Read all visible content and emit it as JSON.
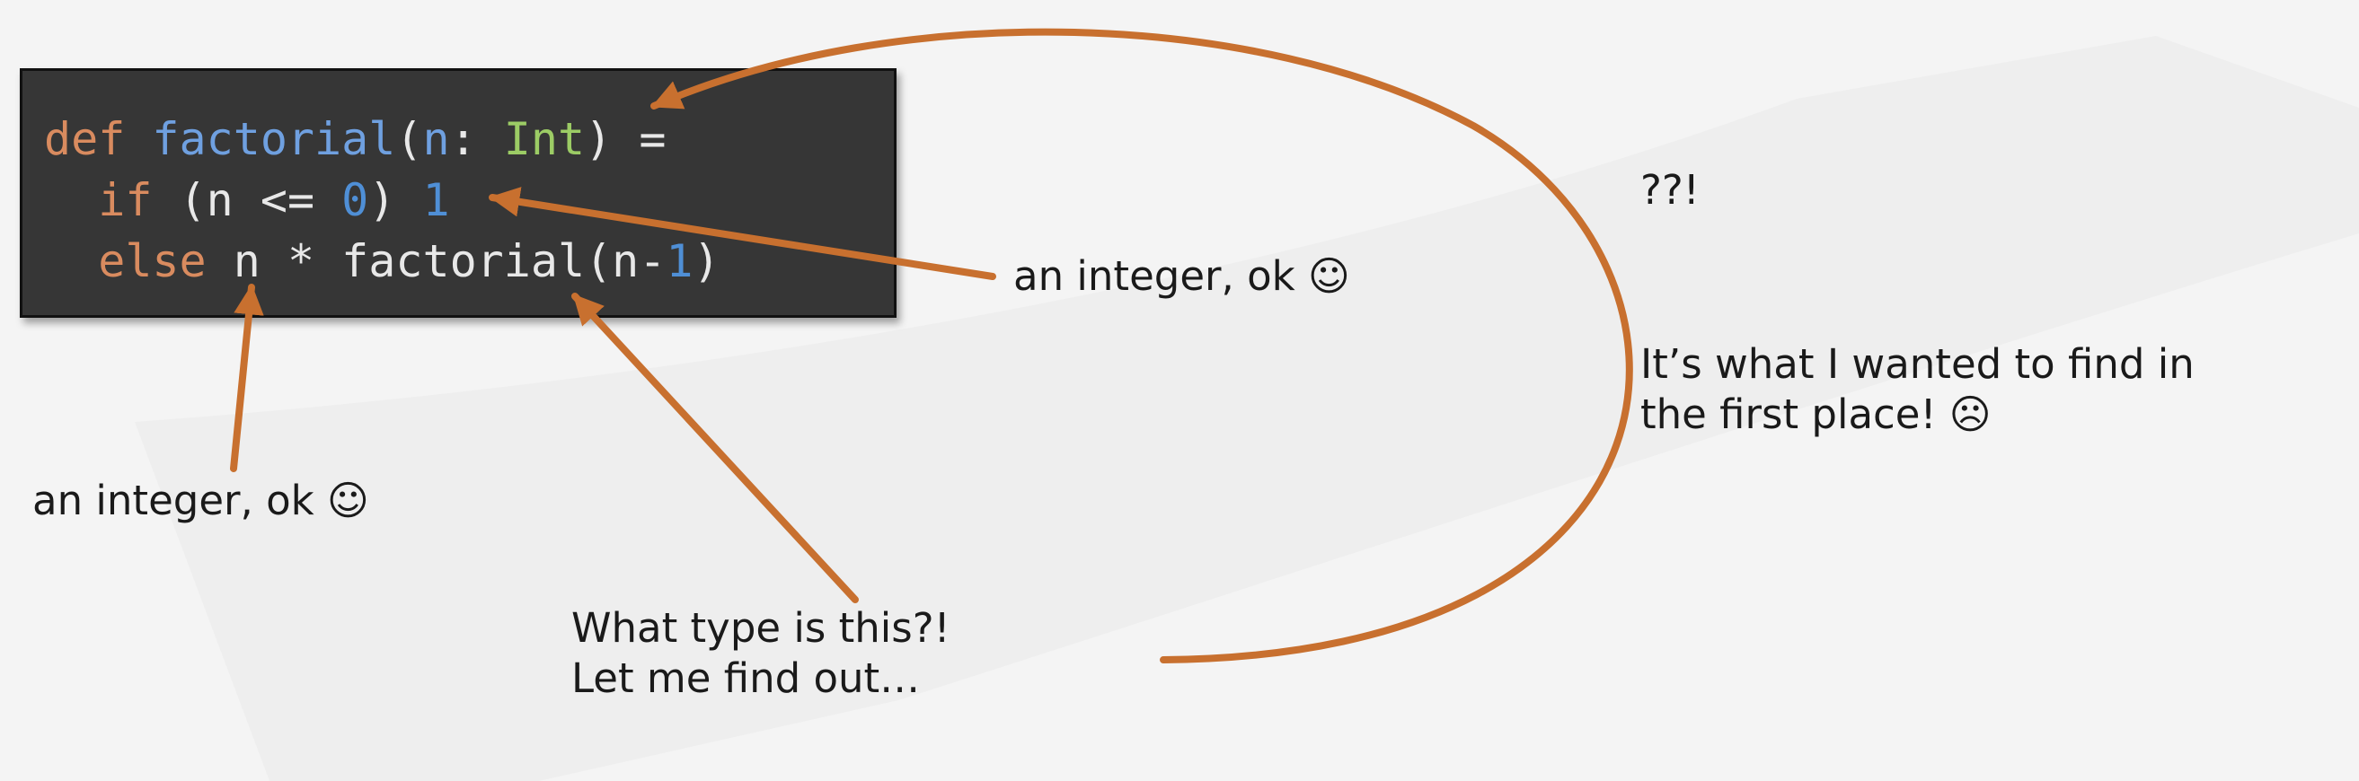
{
  "code": {
    "line1": {
      "kw_def": "def",
      "space1": " ",
      "fn_name": "factorial",
      "open_paren": "(",
      "param": "n",
      "colon": ": ",
      "type": "Int",
      "close_eq": ") ="
    },
    "line2": {
      "indent": "  ",
      "kw_if": "if",
      "cond": " (n <= ",
      "zero": "0",
      "close": ") ",
      "one": "1"
    },
    "line3": {
      "indent": "  ",
      "kw_else": "else",
      "rest": " n * factorial(n-",
      "one": "1",
      "close": ")"
    }
  },
  "annotations": {
    "int_ok_right": "an integer, ok ☺",
    "int_ok_left": "an integer, ok ☺",
    "what_type": "What type is this?!\nLet me find out…",
    "confused": "??!",
    "wanted": "It’s what I wanted to find in\nthe first place! ☹"
  },
  "colors": {
    "background": "#f4f4f4",
    "code_background": "#363636",
    "arrow": "#c8702f",
    "keyword": "#d98b5f",
    "function": "#6fa0e0",
    "type": "#9ccc65",
    "number": "#4f8fd6"
  }
}
